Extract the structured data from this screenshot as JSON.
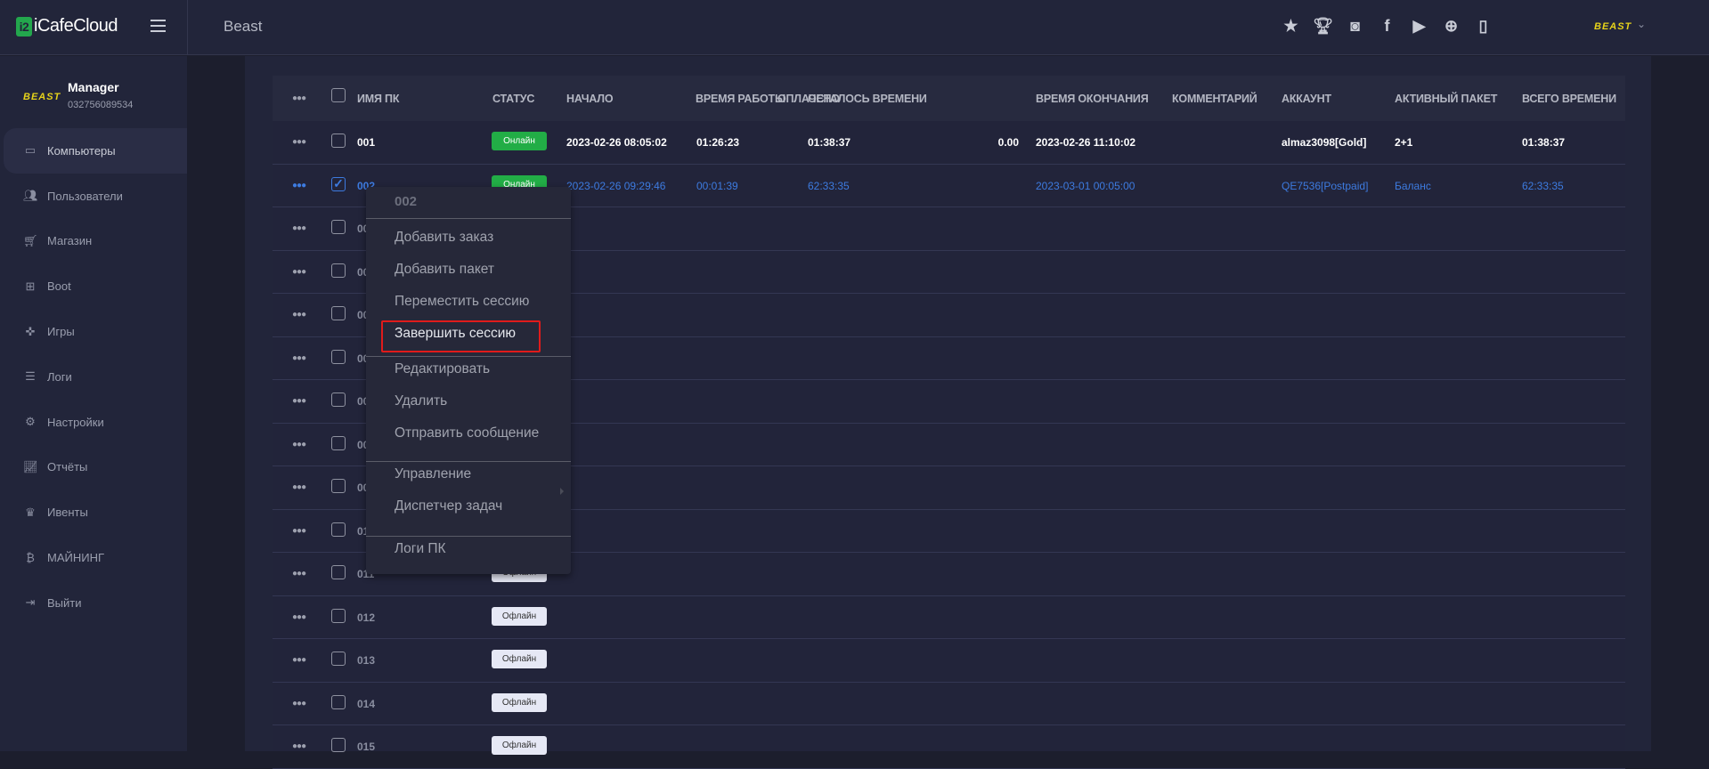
{
  "app": {
    "logo_text": "iCafeCloud",
    "title": "Beast",
    "brand": "BEAST"
  },
  "top_icons": [
    "ranking-stars-icon",
    "trophy-icon",
    "discord-icon",
    "facebook-icon",
    "youtube-icon",
    "globe-icon",
    "book-icon"
  ],
  "user": {
    "name": "Manager",
    "phone": "032756089534"
  },
  "sidebar": {
    "items": [
      {
        "label": "Компьютеры",
        "icon": "monitor-icon",
        "active": true
      },
      {
        "label": "Пользователи",
        "icon": "users-icon"
      },
      {
        "label": "Магазин",
        "icon": "cart-icon"
      },
      {
        "label": "Boot",
        "icon": "windows-icon"
      },
      {
        "label": "Игры",
        "icon": "gamepad-icon"
      },
      {
        "label": "Логи",
        "icon": "list-icon"
      },
      {
        "label": "Настройки",
        "icon": "gear-icon"
      },
      {
        "label": "Отчёты",
        "icon": "chart-icon"
      },
      {
        "label": "Ивенты",
        "icon": "crown-icon"
      },
      {
        "label": "МАЙНИНГ",
        "icon": "bitcoin-icon"
      },
      {
        "label": "Выйти",
        "icon": "logout-icon"
      }
    ]
  },
  "table": {
    "columns": [
      "ИМЯ ПК",
      "СТАТУС",
      "НАЧАЛО",
      "ВРЕМЯ РАБОТЫ",
      "ОСТАЛОСЬ ВРЕМЕНИ",
      "ОПЛАЧЕНО",
      "ВРЕМЯ ОКОНЧАНИЯ",
      "КОММЕНТАРИЙ",
      "АККАУНТ",
      "АКТИВНЫЙ ПАКЕТ",
      "ВСЕГО ВРЕМЕНИ"
    ],
    "rows": [
      {
        "name": "001",
        "status": "Онлайн",
        "state": "online",
        "start": "2023-02-26 08:05:02",
        "work": "01:26:23",
        "remain": "01:38:37",
        "paid": "0.00",
        "end": "2023-02-26 11:10:02",
        "comment": "",
        "account": "almaz3098[Gold]",
        "package": "2+1",
        "total": "01:38:37",
        "checked": false
      },
      {
        "name": "002",
        "status": "Онлайн",
        "state": "selected",
        "start": "2023-02-26 09:29:46",
        "work": "00:01:39",
        "remain": "62:33:35",
        "paid": "",
        "end": "2023-03-01 00:05:00",
        "comment": "",
        "account": "QE7536[Postpaid]",
        "package": "Баланс",
        "total": "62:33:35",
        "checked": true
      },
      {
        "name": "003",
        "state": "hidden"
      },
      {
        "name": "004",
        "state": "hidden"
      },
      {
        "name": "005",
        "state": "hidden"
      },
      {
        "name": "006",
        "state": "hidden"
      },
      {
        "name": "007",
        "state": "hidden"
      },
      {
        "name": "008",
        "state": "hidden"
      },
      {
        "name": "009",
        "state": "hidden"
      },
      {
        "name": "010",
        "state": "hidden"
      },
      {
        "name": "011",
        "status": "Офлайн",
        "state": "offline"
      },
      {
        "name": "012",
        "status": "Офлайн",
        "state": "offline"
      },
      {
        "name": "013",
        "status": "Офлайн",
        "state": "offline"
      },
      {
        "name": "014",
        "status": "Офлайн",
        "state": "offline"
      },
      {
        "name": "015",
        "status": "Офлайн",
        "state": "offline"
      }
    ]
  },
  "context_menu": {
    "title": "002",
    "items": [
      "Добавить заказ",
      "Добавить пакет",
      "Переместить сессию",
      "Завершить сессию",
      "Редактировать",
      "Удалить",
      "Отправить сообщение",
      "Управление",
      "Диспетчер задач",
      "Логи ПК"
    ],
    "highlighted": "Завершить сессию",
    "highlight_color": "#e01b1b"
  },
  "colors": {
    "accent_blue": "#3d7be0",
    "online": "#22ad46",
    "offline": "#e6e8f5"
  }
}
